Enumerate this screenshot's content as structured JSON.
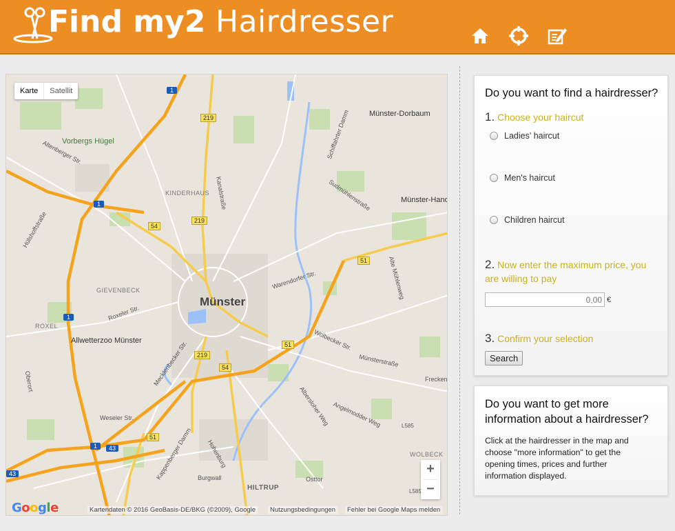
{
  "header": {
    "logo_bold": "Find my2",
    "logo_light": " Hairdresser",
    "nav": [
      {
        "icon": "home-icon"
      },
      {
        "icon": "crosshair-icon"
      },
      {
        "icon": "edit-icon"
      }
    ],
    "brand_color": "#ec8e24"
  },
  "map": {
    "type_buttons": [
      "Karte",
      "Satellit"
    ],
    "center_label": "Münster",
    "labels": {
      "dorbaum": "Münster-Dorbaum",
      "handorf": "Münster-Hand",
      "vorbergs": "Vorbergs Hügel",
      "kinderhaus": "KINDERHAUS",
      "gievenbeck": "GIEVENBECK",
      "roxel": "ROXEL",
      "allwetterzoo": "Allwetterzoo Münster",
      "hiltrup": "HILTRUP",
      "wolbeck": "WOLBECK",
      "altenberger": "Altenberger Str.",
      "kanalstrasse": "Kanalstraße",
      "warendorfer": "Warendorfer Str.",
      "wolbecker": "Wolbecker Str.",
      "roxeler": "Roxeler Str.",
      "weseler": "Weseler Str.",
      "mecklenbecker": "Mecklenbecker Str.",
      "kappenberger": "Kappenberger Damm",
      "albersloher": "Albersloher Weg",
      "angelmodder": "Angelmodder Weg",
      "muensterstrasse": "Münsterstraße",
      "sudmuehlenstrasse": "Sudmühlenstraße",
      "schiffahrter": "Schiffahrter Damm",
      "altemuehlenweg": "Alte Mühlenweg",
      "huelshoff": "Hülshoffstraße",
      "hohenburg": "Hohenburg",
      "burgwall": "Burgwall",
      "osttor": "Osttor",
      "freckeni": "Frecken",
      "oberort": "Oberort"
    },
    "road_badges": {
      "a1_top": "1",
      "a1_mid": "1",
      "a1_left": "1",
      "a1_bottom": "1",
      "b219_top": "219",
      "b219_mid": "219",
      "b219_low": "219",
      "b54_a": "54",
      "b54_b": "54",
      "b51_right": "51",
      "b51_mid": "51",
      "b51_low": "51",
      "a43_a": "43",
      "a43_b": "43",
      "l585a": "L585",
      "l585b": "L585"
    },
    "zoom_in": "+",
    "zoom_out": "−",
    "google": "Google",
    "attribution": "Kartendaten © 2016 GeoBasis-DE/BKG (©2009), Google",
    "terms": "Nutzungsbedingungen",
    "report": "Fehler bei Google Maps melden"
  },
  "finder": {
    "title": "Do you want to find a hairdresser?",
    "step1_num": "1.",
    "step1_label": "Choose your haircut",
    "options": [
      "Ladies' haircut",
      "Men's haircut",
      "Children haircut"
    ],
    "step2_num": "2.",
    "step2_label": "Now enter the maximum price, you are willing to pay",
    "price_placeholder": "0,00",
    "currency": "€",
    "step3_num": "3.",
    "step3_label": "Confirm your selection",
    "search_label": "Search"
  },
  "info": {
    "title": "Do you want to get more information about a hairdresser?",
    "text": "Click at the hairdresser in the map and choose \"more information\" to get the opening times, prices and further information displayed."
  }
}
